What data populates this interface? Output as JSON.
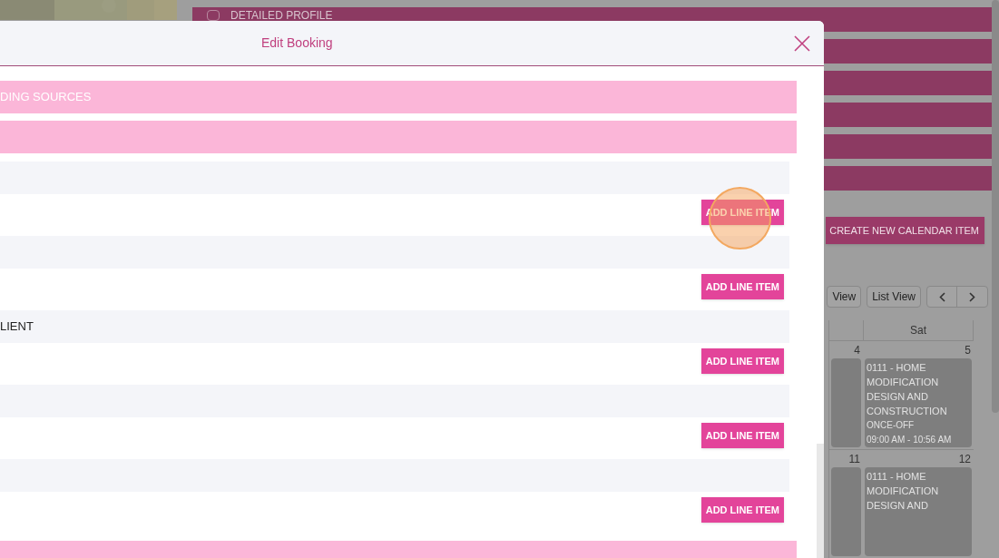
{
  "background": {
    "profile_bars": [
      {
        "kind": "labeled",
        "label": "DETAILED PROFILE"
      },
      {
        "kind": "plain"
      },
      {
        "kind": "plain"
      },
      {
        "kind": "plain"
      },
      {
        "kind": "plain"
      },
      {
        "kind": "plain"
      }
    ],
    "create_button": "CREATE NEW CALENDAR ITEM",
    "view_buttons": [
      {
        "label": "View"
      },
      {
        "label": "List View"
      }
    ],
    "calendar": {
      "columns": [
        "",
        "Sat"
      ],
      "weeks": [
        {
          "day_numbers": [
            "4",
            "5"
          ],
          "events": [
            {
              "kind": "partial"
            },
            {
              "kind": "full",
              "title": "0111 - HOME MODIFICATION DESIGN AND CONSTRUCTION",
              "lines": [
                "ONCE-OFF",
                "09:00 AM - 10:56 AM"
              ]
            }
          ]
        },
        {
          "day_numbers": [
            "11",
            "12"
          ],
          "events": [
            {
              "kind": "partial"
            },
            {
              "kind": "full",
              "title": "0111 - HOME MODIFICATION DESIGN AND"
            }
          ]
        }
      ]
    }
  },
  "modal": {
    "title": "Edit Booking",
    "rows": [
      {
        "kind": "pink",
        "label": "DING SOURCES"
      },
      {
        "kind": "pink"
      },
      {
        "kind": "grey"
      },
      {
        "kind": "action",
        "button": "ADD LINE ITEM"
      },
      {
        "kind": "grey"
      },
      {
        "kind": "action",
        "button": "ADD LINE ITEM"
      },
      {
        "kind": "grey",
        "label": "LIENT"
      },
      {
        "kind": "action",
        "button": "ADD LINE ITEM"
      },
      {
        "kind": "grey"
      },
      {
        "kind": "action",
        "button": "ADD LINE ITEM"
      },
      {
        "kind": "grey"
      },
      {
        "kind": "action",
        "button": "ADD LINE ITEM"
      },
      {
        "kind": "pink"
      }
    ]
  }
}
